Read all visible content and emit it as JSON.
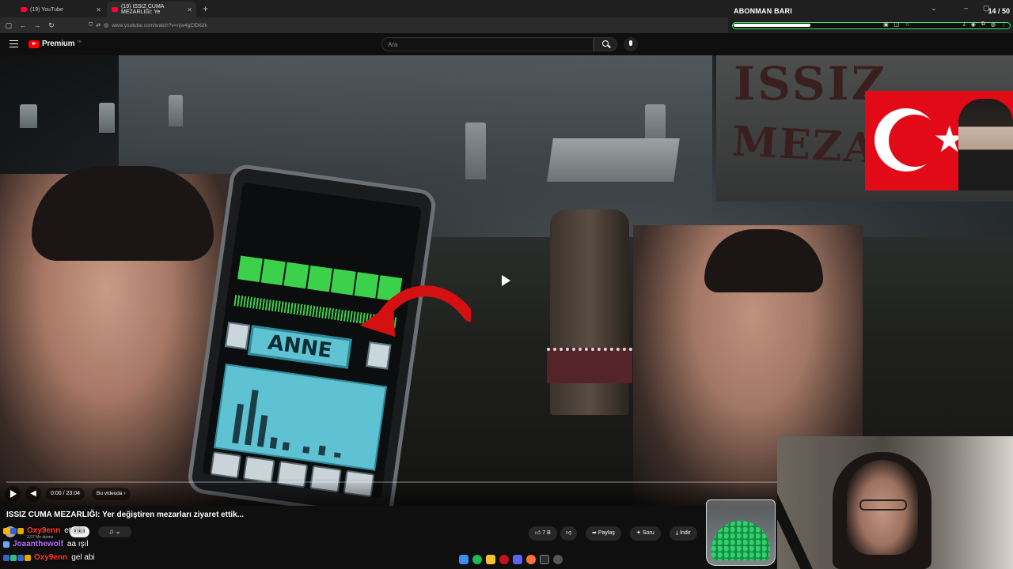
{
  "browser": {
    "tabs": [
      {
        "title": "(19) YouTube",
        "active": false
      },
      {
        "title": "(19) ISSIZ CUMA MEZARLIĞI: Ye",
        "active": true
      }
    ],
    "url": "www.youtube.com/watch?v=njw4gClD62k"
  },
  "subscriber_bar": {
    "title": "ABONMAN BARI",
    "count": "14 / 50",
    "progress": 0.28,
    "accent_color": "#3ce86b"
  },
  "youtube": {
    "logo_text": "Premium",
    "logo_sup": "TR",
    "search_placeholder": "Ara"
  },
  "video": {
    "sign_line1": "ISSIZ",
    "sign_line2": "MEZARLIĞI",
    "phone_word": "ANNE",
    "time": "0:00 / 23:04",
    "chapter": "Bu videoda"
  },
  "video_info": {
    "title": "ISSIZ CUMA MEZARLIĞI: Yer değiştiren mezarları ziyaret ettik...",
    "subscribers": "2,07 Mn abone",
    "join_label": "Katıl",
    "like_count": "7 B",
    "share_label": "Paylaş",
    "ask_label": "Soru",
    "download_label": "İndir"
  },
  "chat": [
    {
      "user": "Oxy9enn",
      "message": "et abi",
      "color": "#ff3b30"
    },
    {
      "user": "Joaanthewolf",
      "message": "aa ışıl",
      "color": "#b36bff"
    },
    {
      "user": "Oxy9enn",
      "message": "gel abi",
      "color": "#ff3b30"
    }
  ],
  "icons": {
    "search": "search-icon",
    "mic": "microphone-icon",
    "menu": "menu-icon",
    "like": "thumbs-up-icon",
    "dislike": "thumbs-down-icon",
    "share": "share-icon",
    "download": "download-icon"
  }
}
